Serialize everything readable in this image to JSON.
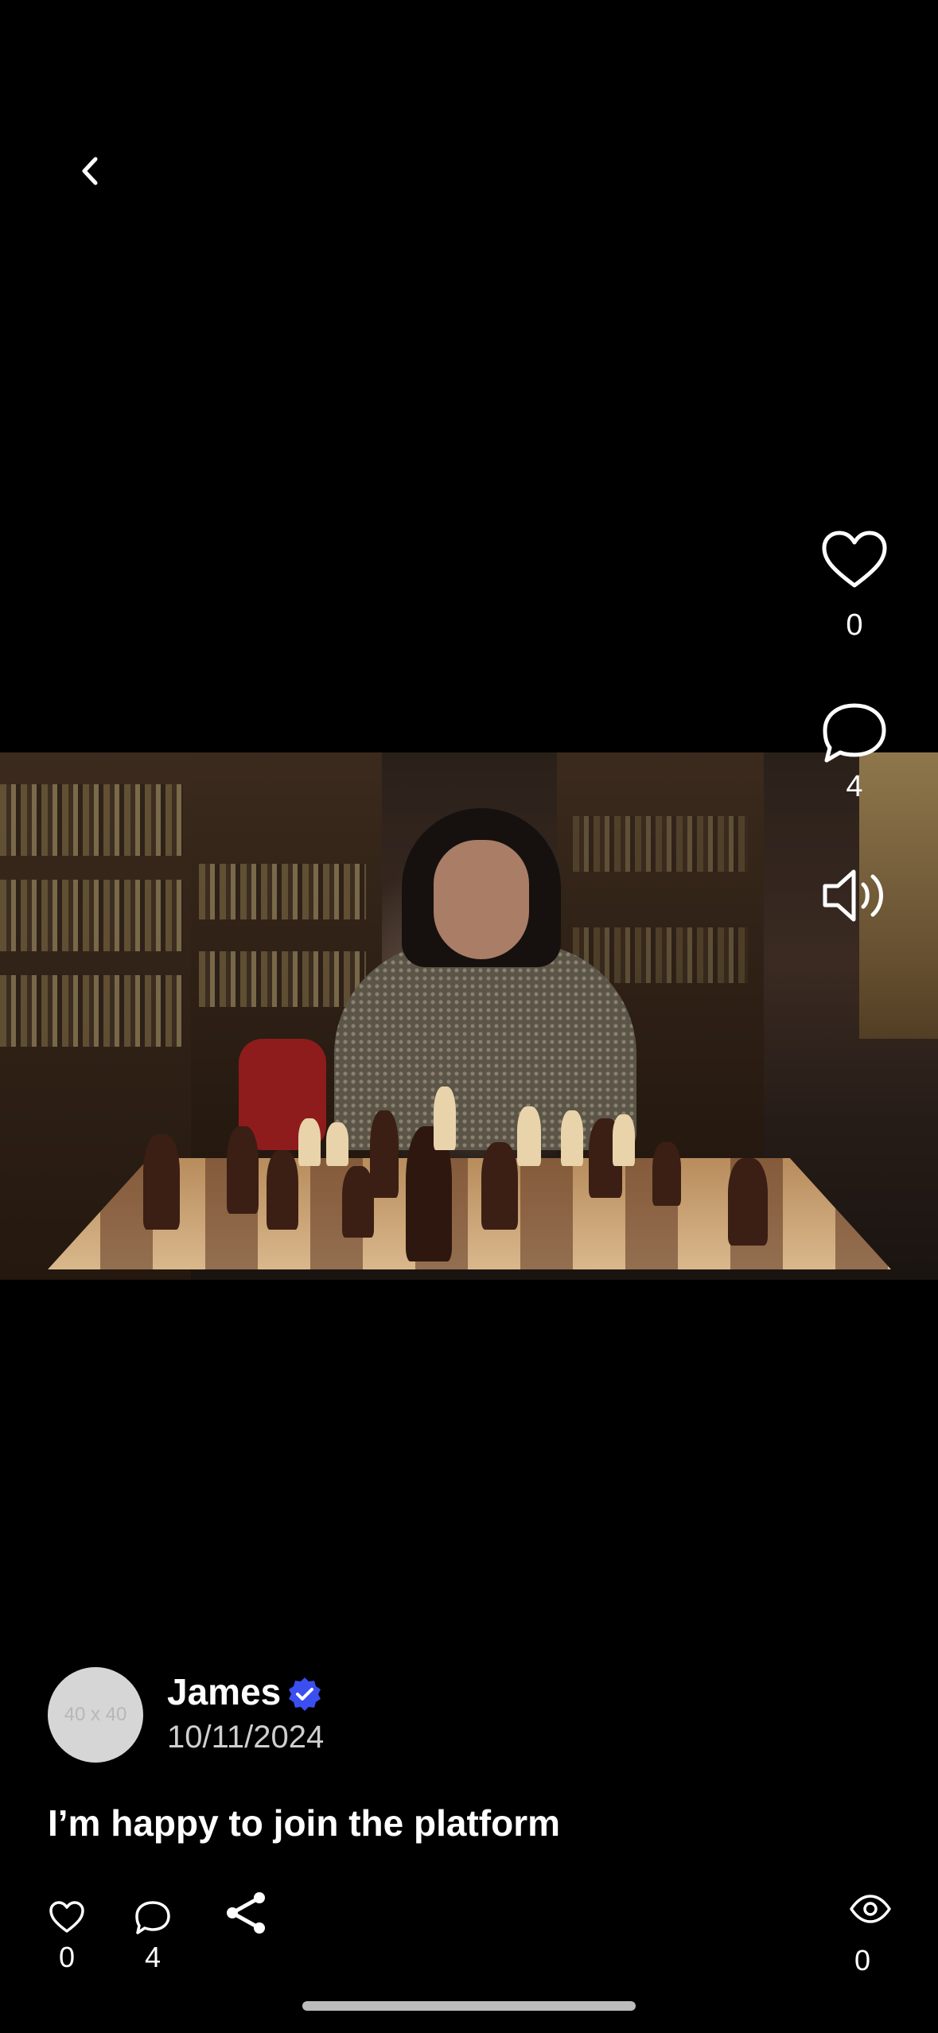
{
  "header": {
    "back_icon": "chevron-left-icon"
  },
  "actions_rail": {
    "like_icon": "heart-outline-icon",
    "like_count": "0",
    "comment_icon": "speech-bubble-icon",
    "comment_count": "4",
    "sound_icon": "speaker-on-icon"
  },
  "post": {
    "avatar_placeholder": "40 x 40",
    "author_name": "James",
    "verified_icon": "verified-badge-icon",
    "date": "10/11/2024",
    "caption": "I’m happy to join the platform"
  },
  "bottom_bar": {
    "like_count": "0",
    "comment_count": "4",
    "share_icon": "share-icon",
    "views_icon": "eye-icon",
    "views_count": "0"
  },
  "colors": {
    "background": "#000000",
    "verified": "#3b4ef0",
    "text": "#ffffff"
  }
}
